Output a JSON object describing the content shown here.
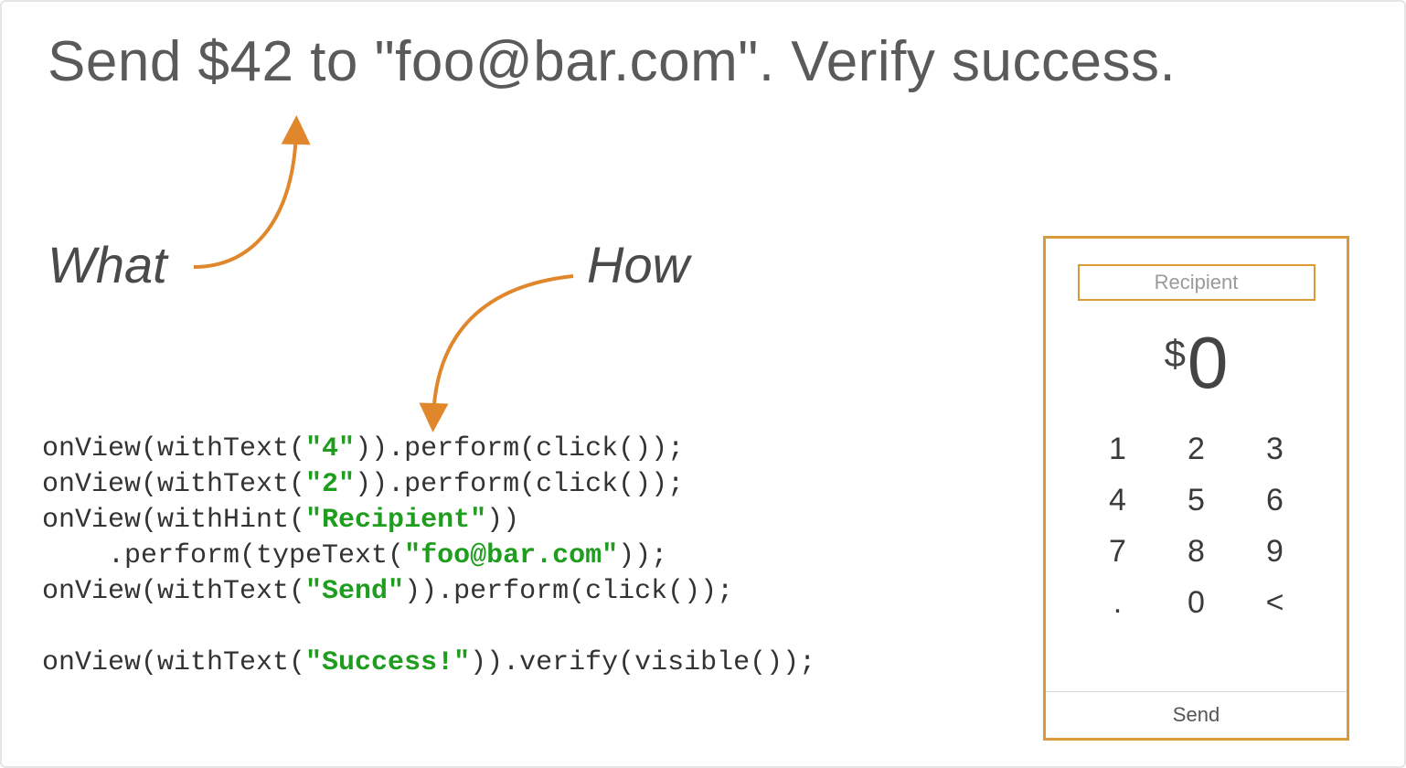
{
  "title": "Send $42 to \"foo@bar.com\". Verify success.",
  "labels": {
    "what": "What",
    "how": "How"
  },
  "code": {
    "l1a": "onView(withText(",
    "l1s": "\"4\"",
    "l1b": ")).perform(click());",
    "l2a": "onView(withText(",
    "l2s": "\"2\"",
    "l2b": ")).perform(click());",
    "l3a": "onView(withHint(",
    "l3s": "\"Recipient\"",
    "l3b": "))",
    "l4a": "    .perform(typeText(",
    "l4s": "\"foo@bar.com\"",
    "l4b": "));",
    "l5a": "onView(withText(",
    "l5s": "\"Send\"",
    "l5b": ")).perform(click());",
    "l6": "",
    "l7a": "onView(withText(",
    "l7s": "\"Success!\"",
    "l7b": ")).verify(visible());"
  },
  "phone": {
    "recipient_placeholder": "Recipient",
    "currency": "$",
    "amount": "0",
    "keys": [
      "1",
      "2",
      "3",
      "4",
      "5",
      "6",
      "7",
      "8",
      "9",
      ".",
      "0",
      "<"
    ],
    "send": "Send"
  },
  "colors": {
    "accent": "#d99a3a",
    "arrow": "#e0872b",
    "string": "#1f9d1f"
  }
}
